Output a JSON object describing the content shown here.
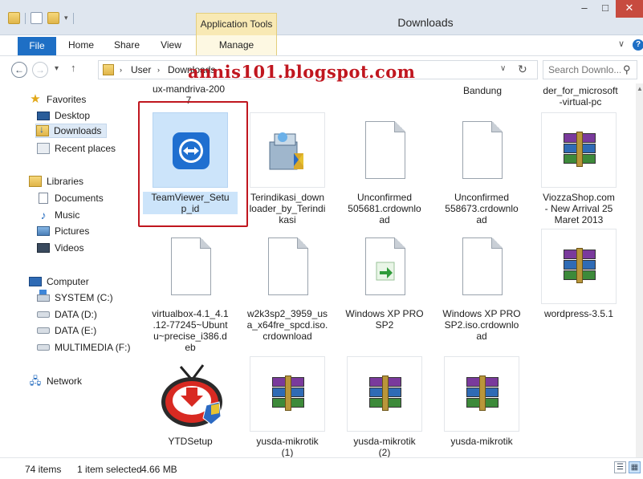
{
  "window": {
    "title": "Downloads",
    "context_tab": "Application Tools",
    "min_glyph": "–",
    "max_glyph": "□",
    "close_glyph": "✕"
  },
  "ribbon": {
    "tabs": [
      "File",
      "Home",
      "Share",
      "View",
      "Manage"
    ],
    "chevron": "∨",
    "help": "?"
  },
  "address": {
    "back": "←",
    "forward": "→",
    "recent_dropdown": "▾",
    "up": "↑",
    "crumbs": [
      "User",
      "Downloads"
    ],
    "separator": "›",
    "dropdown": "∨",
    "refresh": "↻"
  },
  "search": {
    "placeholder": "Search Downlo...",
    "icon": "search-icon"
  },
  "watermark": "annis101.blogspot.com",
  "nav": {
    "favorites": {
      "label": "Favorites",
      "items": [
        "Desktop",
        "Downloads",
        "Recent places"
      ]
    },
    "libraries": {
      "label": "Libraries",
      "items": [
        "Documents",
        "Music",
        "Pictures",
        "Videos"
      ]
    },
    "computer": {
      "label": "Computer",
      "items": [
        "SYSTEM (C:)",
        "DATA (D:)",
        "DATA (E:)",
        "MULTIMEDIA (F:)"
      ]
    },
    "network": {
      "label": "Network"
    },
    "selected": "Downloads"
  },
  "content": {
    "partial_top_labels": [
      "ux-mandriva-200\n7",
      "Bandung",
      "der_for_microsoft\n-virtual-pc"
    ],
    "items": [
      {
        "name": "TeamViewer_Setu\np_id",
        "icon": "teamviewer-icon",
        "selected": true
      },
      {
        "name": "Terindikasi_down\nloader_by_Terindi\nkasi",
        "icon": "installer-icon",
        "selected": false
      },
      {
        "name": "Unconfirmed\n505681.crdownlo\nad",
        "icon": "blank-file-icon",
        "selected": false
      },
      {
        "name": "Unconfirmed\n558673.crdownlo\nad",
        "icon": "blank-file-icon",
        "selected": false
      },
      {
        "name": "ViozzaShop.com\n- New Arrival 25\nMaret 2013",
        "icon": "winrar-icon",
        "selected": false
      },
      {
        "name": "virtualbox-4.1_4.1\n.12-77245~Ubunt\nu~precise_i386.d\neb",
        "icon": "blank-file-icon",
        "selected": false
      },
      {
        "name": "w2k3sp2_3959_us\na_x64fre_spcd.iso.\ncrdownload",
        "icon": "blank-file-icon",
        "selected": false
      },
      {
        "name": "Windows XP PRO\nSP2",
        "icon": "shortcut-file-icon",
        "selected": false
      },
      {
        "name": "Windows XP PRO\nSP2.iso.crdownlo\nad",
        "icon": "blank-file-icon",
        "selected": false
      },
      {
        "name": "wordpress-3.5.1",
        "icon": "winrar-icon",
        "selected": false
      },
      {
        "name": "YTDSetup",
        "icon": "ytd-icon",
        "selected": false
      },
      {
        "name": "yusda-mikrotik\n(1)",
        "icon": "winrar-icon",
        "selected": false
      },
      {
        "name": "yusda-mikrotik\n(2)",
        "icon": "winrar-icon",
        "selected": false
      },
      {
        "name": "yusda-mikrotik",
        "icon": "winrar-icon",
        "selected": false
      }
    ]
  },
  "status": {
    "count": "74 items",
    "selection": "1 item selected",
    "size": "4.66 MB"
  },
  "colors": {
    "accent": "#1e6fc5",
    "selection": "#cce4fa",
    "highlight_box": "#c0161f",
    "watermark": "#c0161f",
    "context_tab": "#f8e9b4"
  }
}
